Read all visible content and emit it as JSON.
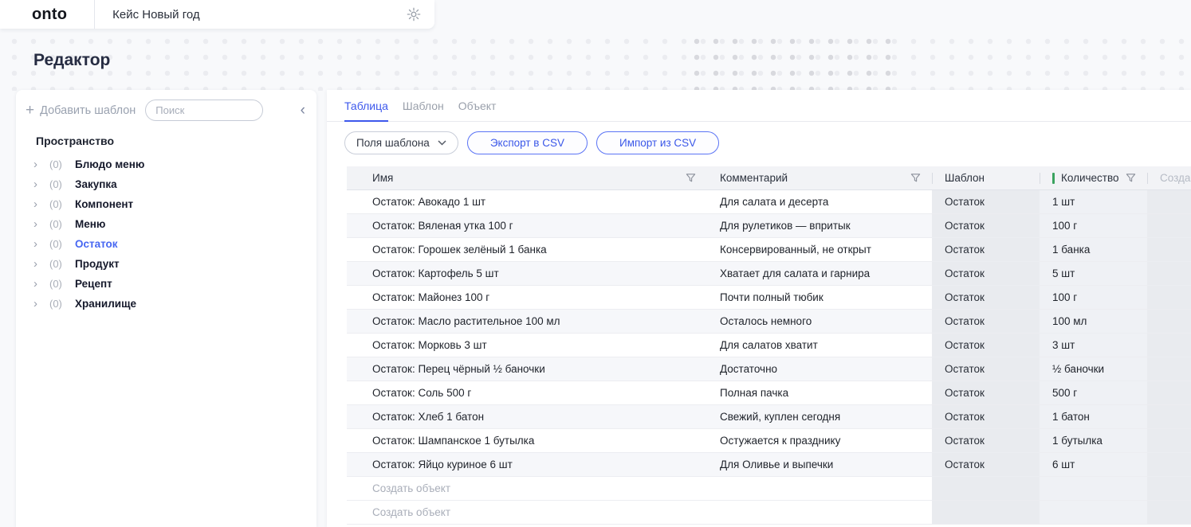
{
  "app": {
    "logo": "onto",
    "workspace_title": "Кейс Новый год"
  },
  "page": {
    "title": "Редактор"
  },
  "sidebar": {
    "add_template_label": "Добавить шаблон",
    "search_placeholder": "Поиск",
    "space_label": "Пространство",
    "items": [
      {
        "count": "(0)",
        "label": "Блюдо меню",
        "selected": false
      },
      {
        "count": "(0)",
        "label": "Закупка",
        "selected": false
      },
      {
        "count": "(0)",
        "label": "Компонент",
        "selected": false
      },
      {
        "count": "(0)",
        "label": "Меню",
        "selected": false
      },
      {
        "count": "(0)",
        "label": "Остаток",
        "selected": true
      },
      {
        "count": "(0)",
        "label": "Продукт",
        "selected": false
      },
      {
        "count": "(0)",
        "label": "Рецепт",
        "selected": false
      },
      {
        "count": "(0)",
        "label": "Хранилище",
        "selected": false
      }
    ]
  },
  "tabs": [
    {
      "label": "Таблица",
      "active": true
    },
    {
      "label": "Шаблон",
      "active": false
    },
    {
      "label": "Объект",
      "active": false
    }
  ],
  "toolbar": {
    "fields_button": "Поля шаблона",
    "export_button": "Экспорт в CSV",
    "import_button": "Импорт из CSV"
  },
  "table": {
    "columns": [
      "Имя",
      "Комментарий",
      "Шаблон",
      "Количество",
      "Созда"
    ],
    "rows": [
      {
        "name": "Остаток: Авокадо 1 шт",
        "comment": "Для салата и десерта",
        "template": "Остаток",
        "quantity": "1 шт"
      },
      {
        "name": "Остаток: Вяленая утка 100 г",
        "comment": "Для рулетиков — впритык",
        "template": "Остаток",
        "quantity": "100 г"
      },
      {
        "name": "Остаток: Горошек зелёный 1 банка",
        "comment": "Консервированный, не открыт",
        "template": "Остаток",
        "quantity": "1 банка"
      },
      {
        "name": "Остаток: Картофель 5 шт",
        "comment": "Хватает для салата и гарнира",
        "template": "Остаток",
        "quantity": "5 шт"
      },
      {
        "name": "Остаток: Майонез 100 г",
        "comment": "Почти полный тюбик",
        "template": "Остаток",
        "quantity": "100 г"
      },
      {
        "name": "Остаток: Масло растительное 100 мл",
        "comment": "Осталось немного",
        "template": "Остаток",
        "quantity": "100 мл"
      },
      {
        "name": "Остаток: Морковь 3 шт",
        "comment": "Для салатов хватит",
        "template": "Остаток",
        "quantity": "3 шт"
      },
      {
        "name": "Остаток: Перец чёрный ½ баночки",
        "comment": "Достаточно",
        "template": "Остаток",
        "quantity": "½ баночки"
      },
      {
        "name": "Остаток: Соль 500 г",
        "comment": "Полная пачка",
        "template": "Остаток",
        "quantity": "500 г"
      },
      {
        "name": "Остаток: Хлеб 1 батон",
        "comment": "Свежий, куплен сегодня",
        "template": "Остаток",
        "quantity": "1 батон"
      },
      {
        "name": "Остаток: Шампанское 1 бутылка",
        "comment": "Остужается к празднику",
        "template": "Остаток",
        "quantity": "1 бутылка"
      },
      {
        "name": "Остаток: Яйцо куриное 6 шт",
        "comment": "Для Оливье и выпечки",
        "template": "Остаток",
        "quantity": "6 шт"
      }
    ],
    "create_object_label": "Создать объект"
  },
  "colors": {
    "accent_blue": "#3d58ec",
    "selected_item_blue": "#4767f2",
    "quantity_accent_green": "#3aa35f",
    "header_bg": "#f2f3f6",
    "readonly_column_bg": "#e9ebef"
  }
}
